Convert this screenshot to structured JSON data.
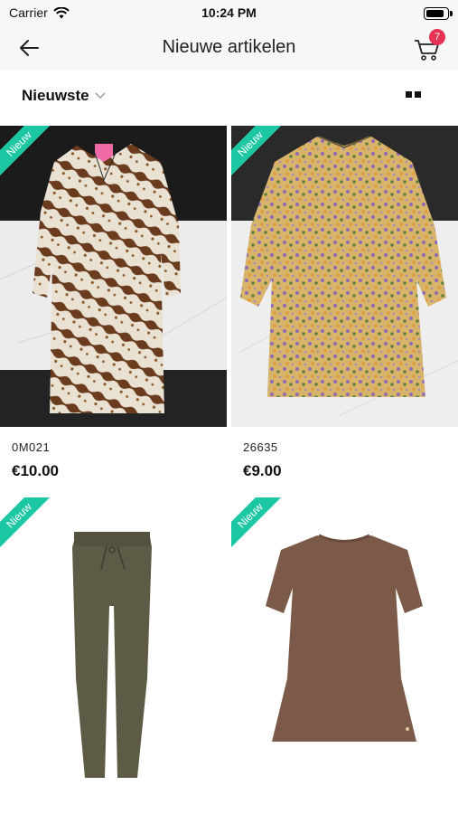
{
  "status": {
    "carrier": "Carrier",
    "time": "10:24 PM",
    "battery_level": 0.85
  },
  "nav": {
    "title": "Nieuwe artikelen",
    "cart_count": "7"
  },
  "filter": {
    "sort_label": "Nieuwste"
  },
  "products": [
    {
      "badge": "Nieuw",
      "sku": "0M021",
      "price": "€10.00"
    },
    {
      "badge": "Nieuw",
      "sku": "26635",
      "price": "€9.00"
    },
    {
      "badge": "Nieuw",
      "sku": "",
      "price": ""
    },
    {
      "badge": "Nieuw",
      "sku": "",
      "price": ""
    }
  ],
  "colors": {
    "accent_badge": "#1dc7a4",
    "cart_badge": "#e53255"
  }
}
